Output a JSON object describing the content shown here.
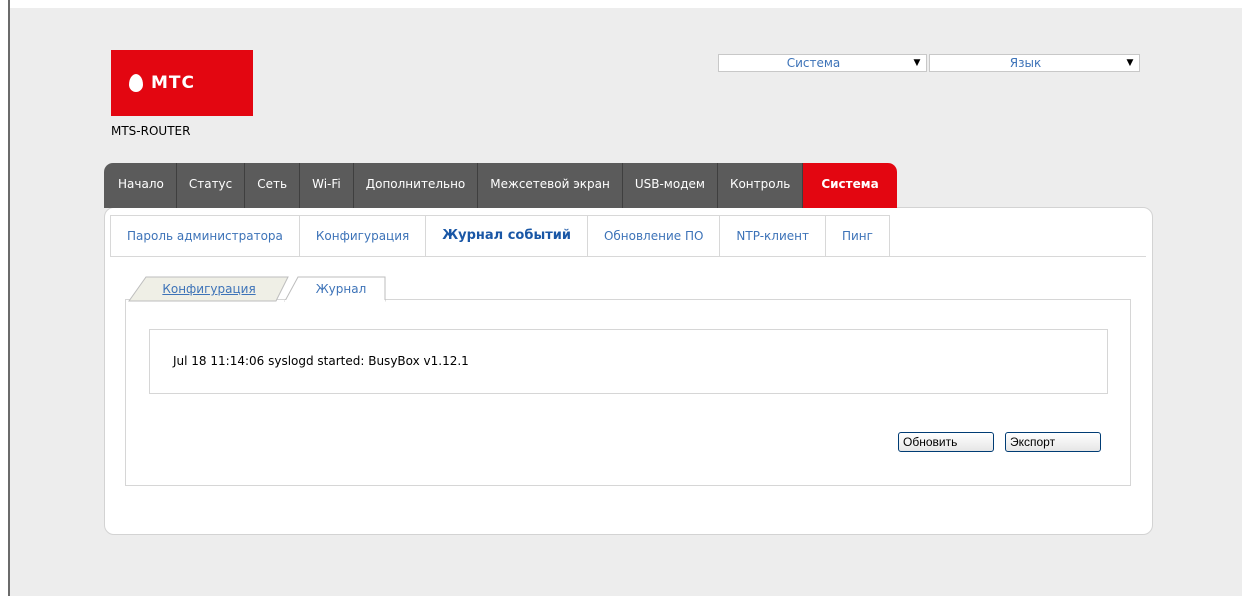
{
  "header": {
    "logo_text": "МТС",
    "model": "MTS-ROUTER",
    "system_select": "Система",
    "language_select": "Язык"
  },
  "main_nav": [
    {
      "label": "Начало"
    },
    {
      "label": "Статус"
    },
    {
      "label": "Сеть"
    },
    {
      "label": "Wi-Fi"
    },
    {
      "label": "Дополнительно"
    },
    {
      "label": "Межсетевой экран"
    },
    {
      "label": "USB-модем"
    },
    {
      "label": "Контроль"
    },
    {
      "label": "Система",
      "active": true
    }
  ],
  "sub_nav": [
    {
      "label": "Пароль администратора"
    },
    {
      "label": "Конфигурация"
    },
    {
      "label": "Журнал событий",
      "active": true
    },
    {
      "label": "Обновление ПО"
    },
    {
      "label": "NTP-клиент"
    },
    {
      "label": "Пинг"
    }
  ],
  "inner_tabs": {
    "config": "Конфигурация",
    "journal": "Журнал"
  },
  "log": {
    "lines": [
      "Jul 18 11:14:06 syslogd started: BusyBox v1.12.1"
    ]
  },
  "buttons": {
    "refresh": "Обновить",
    "export": "Экспорт"
  },
  "colors": {
    "brand_red": "#e30611",
    "nav_gray": "#5b5b5b",
    "link_blue": "#3d73b8"
  }
}
